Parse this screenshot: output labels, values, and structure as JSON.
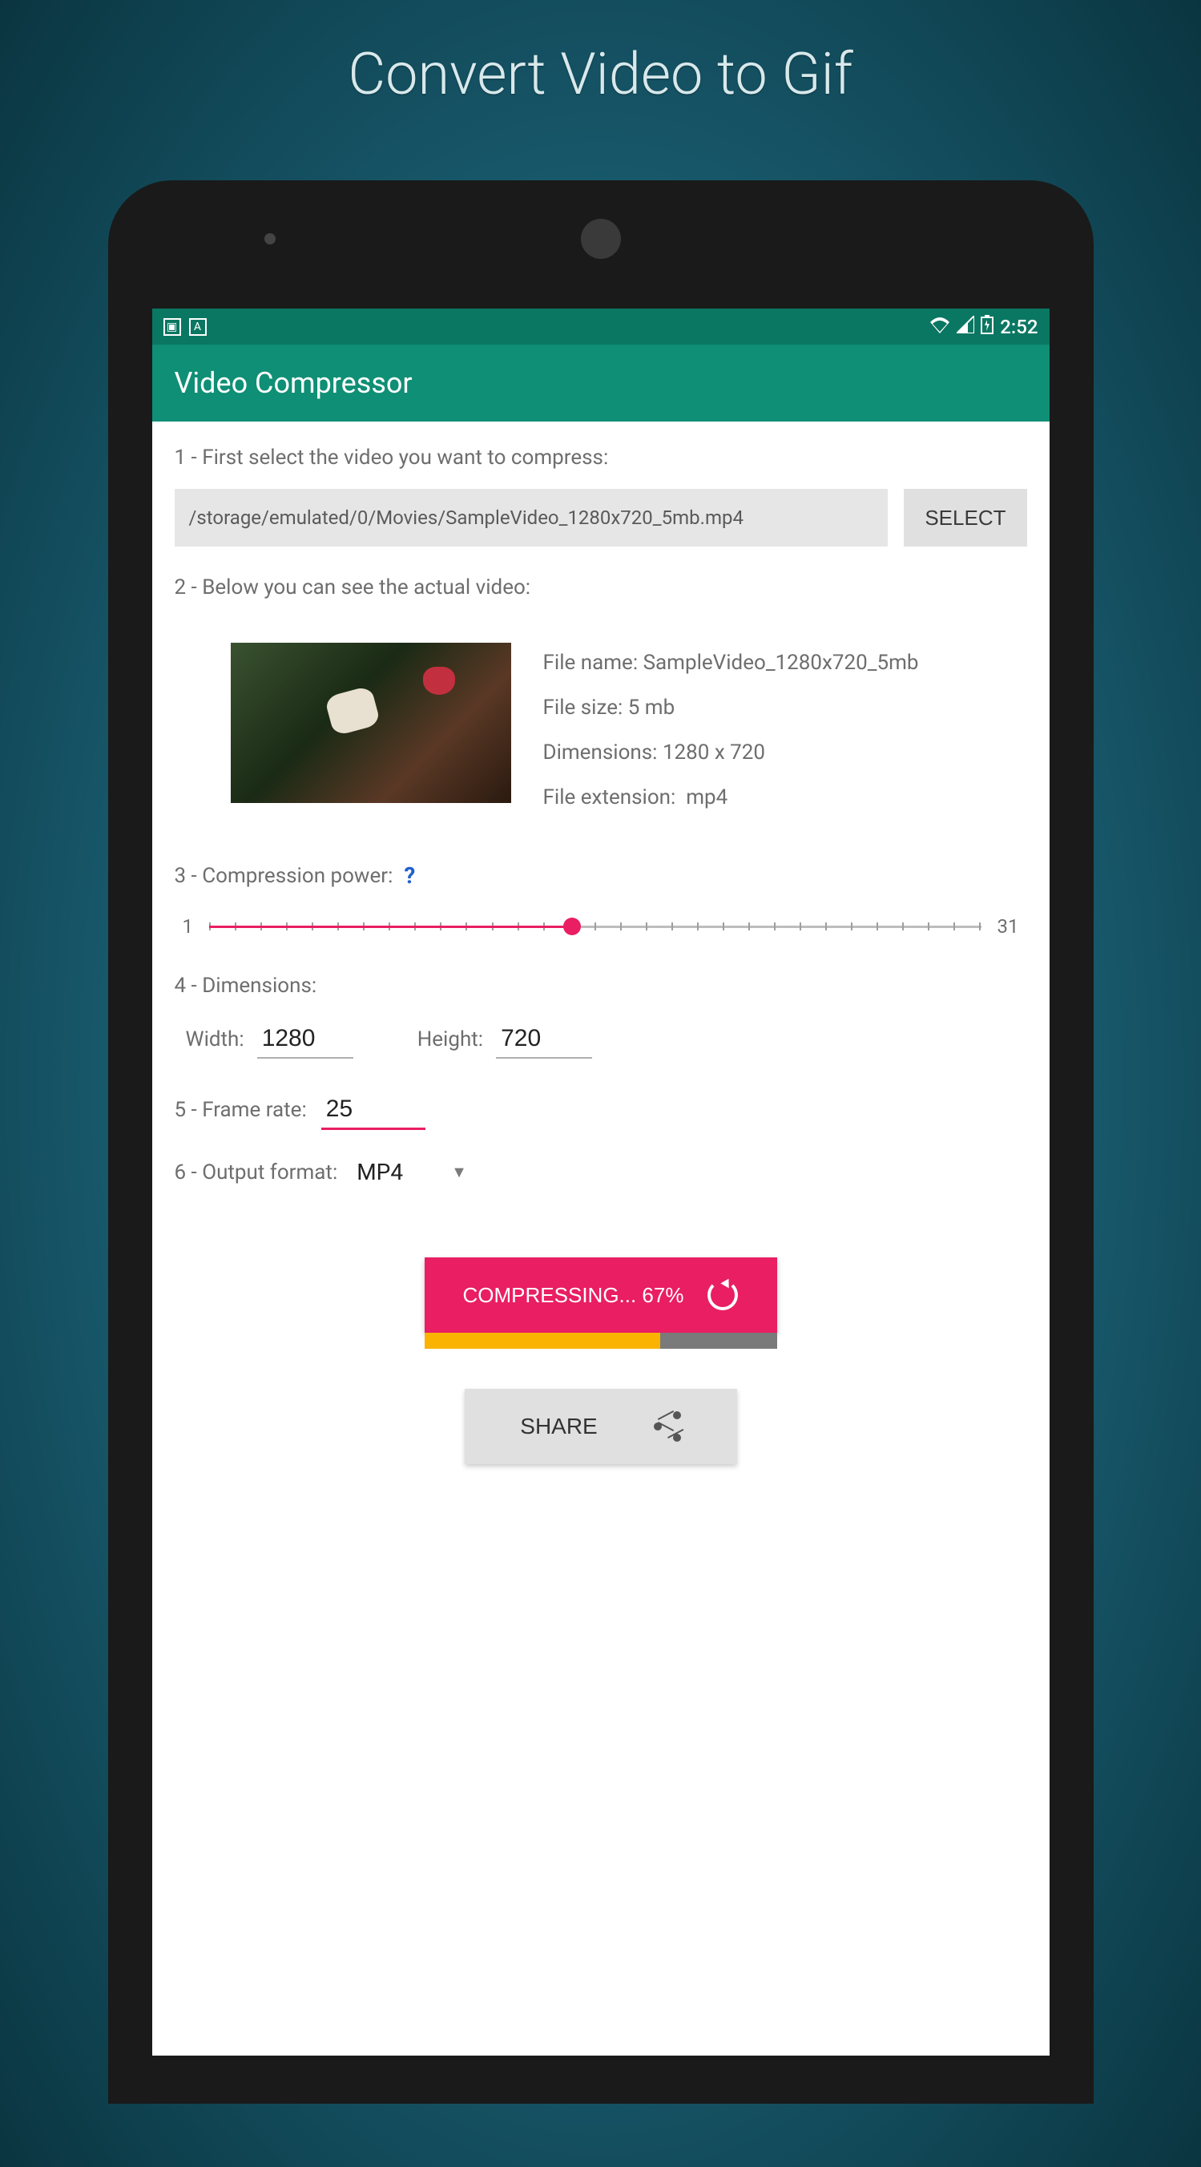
{
  "page_title": "Convert Video to Gif",
  "status_bar": {
    "time": "2:52"
  },
  "app_bar": {
    "title": "Video Compressor"
  },
  "steps": {
    "s1_label": "1 - First select the video you want to compress:",
    "file_path": "/storage/emulated/0/Movies/SampleVideo_1280x720_5mb.mp4",
    "select_label": "SELECT",
    "s2_label": "2 - Below you can see the actual video:",
    "meta": {
      "file_name_label": "File name:",
      "file_name": "SampleVideo_1280x720_5mb",
      "file_size_label": "File size:",
      "file_size": "5 mb",
      "dimensions_label": "Dimensions:",
      "dimensions": "1280 x 720",
      "ext_label": "File extension:",
      "ext": "mp4"
    },
    "s3_label": "3 - Compression power:",
    "help": "?",
    "slider": {
      "min": "1",
      "max": "31",
      "value_percent": 47
    },
    "s4_label": "4 - Dimensions:",
    "width_label": "Width:",
    "width_value": "1280",
    "height_label": "Height:",
    "height_value": "720",
    "s5_label": "5 - Frame rate:",
    "frame_rate": "25",
    "s6_label": "6 - Output format:",
    "output_format": "MP4"
  },
  "actions": {
    "compress_label": "COMPRESSING... 67%",
    "progress_percent": 67,
    "share_label": "SHARE"
  }
}
